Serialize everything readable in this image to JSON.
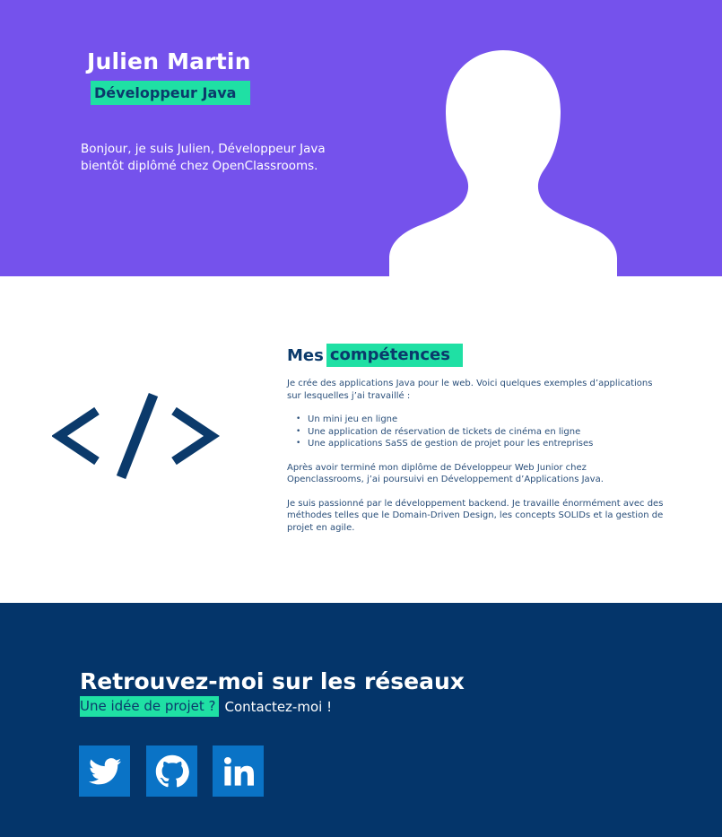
{
  "hero": {
    "name": "Julien Martin",
    "role": "Développeur Java",
    "intro": "Bonjour, je suis Julien, Développeur Java bientôt diplômé chez OpenClassrooms."
  },
  "skills": {
    "title_prefix": "Mes",
    "title_highlight": "compétences",
    "intro": "Je crée des applications Java pour le web. Voici quelques exemples d’applications sur lesquelles j’ai travaillé :",
    "items": [
      "Un mini jeu en ligne",
      "Une application de réservation de tickets de cinéma en ligne",
      "Une applications SaSS de gestion de projet pour les entreprises"
    ],
    "paragraph2": "Après avoir terminé mon diplôme de Développeur Web Junior chez Openclassrooms, j’ai poursuivi en Développement d’Applications Java.",
    "paragraph3": "Je suis passionné par le développement backend. Je travaille énormément avec des méthodes telles que le Domain-Driven Design, les concepts SOLIDs et la gestion de projet en agile."
  },
  "footer": {
    "title": "Retrouvez-moi sur les réseaux",
    "sub_highlight": "Une idée de projet ?",
    "sub_rest": "Contactez-moi !",
    "socials": [
      {
        "icon": "twitter-icon"
      },
      {
        "icon": "github-icon"
      },
      {
        "icon": "linkedin-icon"
      }
    ]
  },
  "colors": {
    "hero_bg": "#7552ec",
    "accent": "#1fe0a4",
    "navy": "#04356a",
    "social_bg": "#0a73c6"
  }
}
